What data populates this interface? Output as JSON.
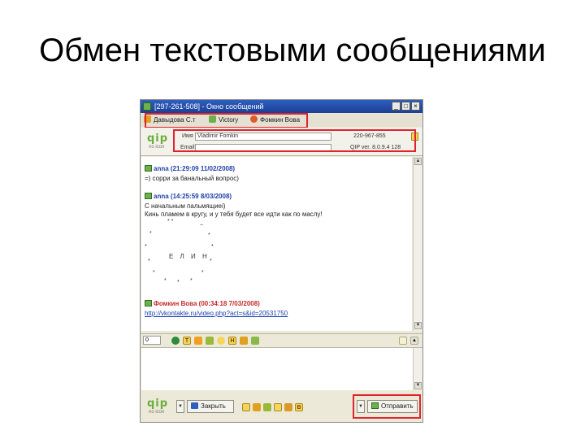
{
  "slide": {
    "title": "Обмен текстовыми сообщениями"
  },
  "window": {
    "title": "[297-261-508] - Окно сообщений",
    "controls": {
      "minimize": "_",
      "maximize": "□",
      "close": "×"
    }
  },
  "tabs": [
    {
      "label": "Давыдова С.т",
      "icon": "user-icon",
      "color": "#e0a020"
    },
    {
      "label": "Victory",
      "icon": "user-icon",
      "color": "#6fb04a"
    },
    {
      "label": "Фомкин Вова",
      "icon": "flower-icon",
      "color": "#e05a2a"
    }
  ],
  "contact": {
    "logo_text": "qip",
    "logo_sub": "no icon",
    "name_label": "Имя",
    "name_value": "Vladimir Fomkin",
    "uin": "220-967-855",
    "email_label": "Email",
    "email_value": "",
    "client": "QIP ver. 8.0.9.4 128"
  },
  "messages": [
    {
      "author": "anna",
      "meta": "(21:29:09 11/02/2008)",
      "author_color": "#1f3fa8",
      "lines": [
        "=) сорри за банальный вопрос)"
      ]
    },
    {
      "author": "anna",
      "meta": "(14:25:59 8/03/2008)",
      "author_color": "#1f3fa8",
      "lines": [
        "С начальным пальмящиеі)",
        "Кинь пламем в кругу, и у тебя будет все идти как по маслу!"
      ],
      "ascii_art_center": "Е Л И Н"
    },
    {
      "author": "Фомкин Вова",
      "meta": "(00:34:18 7/03/2008)",
      "author_color": "#c62a2a",
      "lines": [],
      "link": "http://vkontakte.ru/video.php?act=s&id=20531750"
    }
  ],
  "toolbar": {
    "font_size": "0"
  },
  "bottom": {
    "logo_text": "qip",
    "logo_sub": "no icon",
    "close_label": "Закрыть",
    "send_label": "Отправить",
    "dropdown_arrow": "▼"
  },
  "accent": {
    "highlight": "#e0242e",
    "titlebar": "#2f5fbf"
  }
}
